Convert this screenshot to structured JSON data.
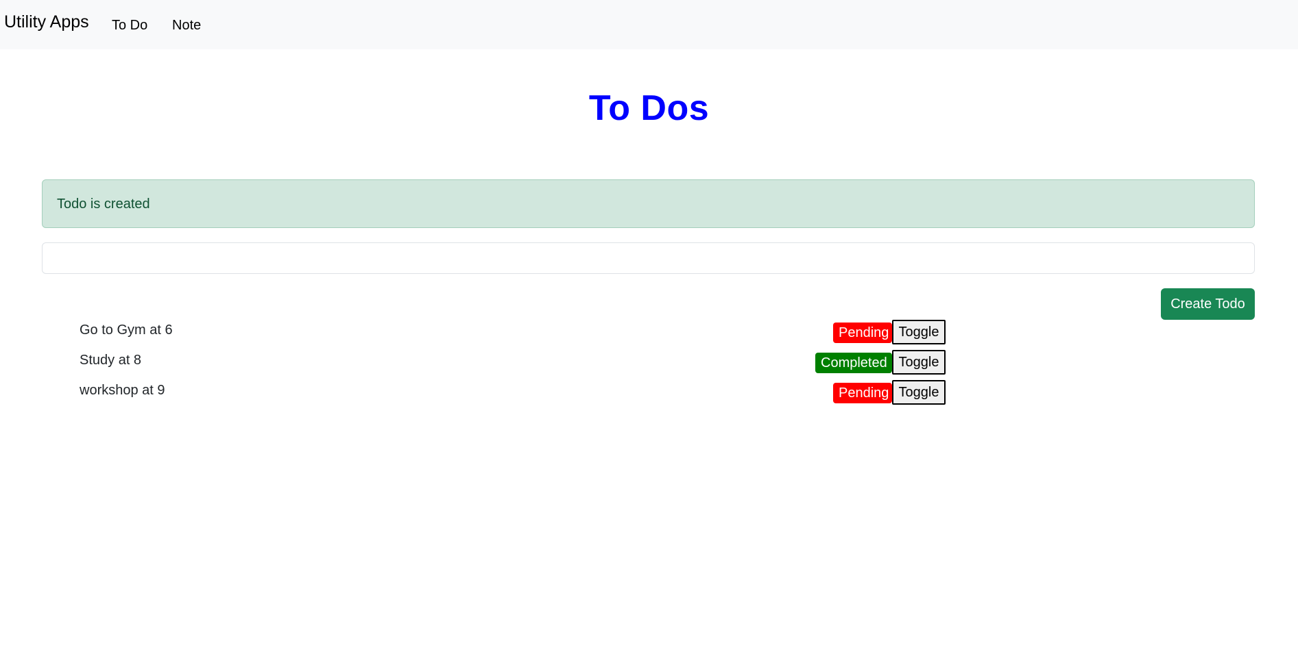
{
  "navbar": {
    "brand": "Utility Apps",
    "links": [
      "To Do",
      "Note"
    ]
  },
  "page": {
    "title": "To Dos"
  },
  "alert": {
    "message": "Todo is created",
    "color": "#d1e7dd"
  },
  "form": {
    "input_value": "",
    "create_label": "Create Todo",
    "create_color": "#198754"
  },
  "todos": [
    {
      "text": "Go to Gym at 6",
      "status": "Pending",
      "toggle_label": "Toggle"
    },
    {
      "text": "Study at 8",
      "status": "Completed",
      "toggle_label": "Toggle"
    },
    {
      "text": "workshop at 9",
      "status": "Pending",
      "toggle_label": "Toggle"
    }
  ],
  "colors": {
    "title": "#0000ff",
    "pending": "#ff0000",
    "completed": "#008000"
  }
}
